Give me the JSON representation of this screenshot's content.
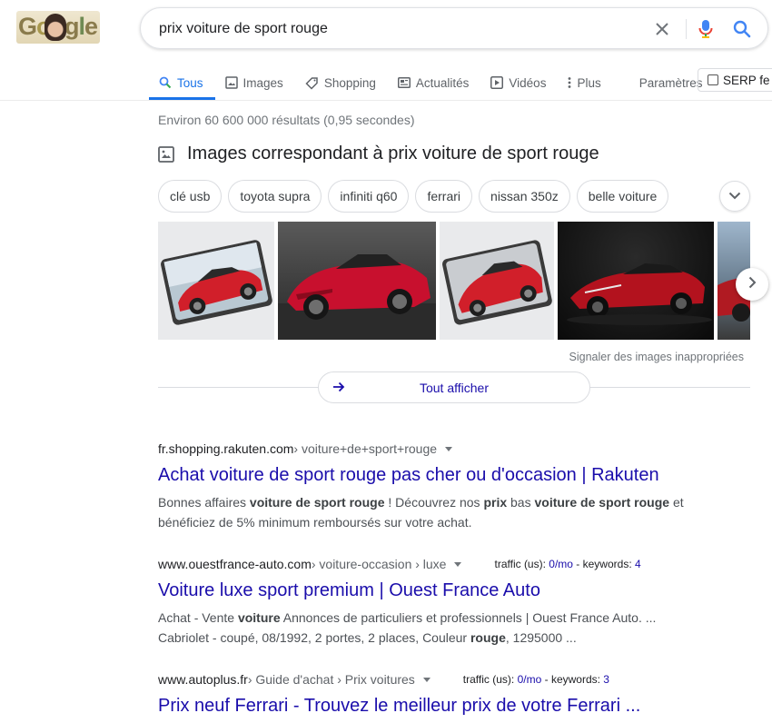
{
  "logo": {
    "text_letters": [
      "G",
      "o",
      "o",
      "g",
      "l",
      "e"
    ]
  },
  "search": {
    "query": "prix voiture de sport rouge"
  },
  "tabs": [
    {
      "label": "Tous",
      "icon": "search-icon",
      "active": true
    },
    {
      "label": "Images",
      "icon": "image-icon"
    },
    {
      "label": "Shopping",
      "icon": "tag-icon"
    },
    {
      "label": "Actualités",
      "icon": "news-icon"
    },
    {
      "label": "Vidéos",
      "icon": "video-icon"
    },
    {
      "label": "Plus",
      "icon": "more-vert-icon"
    }
  ],
  "tools": {
    "params_label": "Paramètres",
    "serp_label": "SERP fe"
  },
  "stats": "Environ 60 600 000 résultats (0,95 secondes)",
  "images_block": {
    "heading": "Images correspondant à prix voiture de sport rouge",
    "chips": [
      "clé usb",
      "toyota supra",
      "infiniti q60",
      "ferrari",
      "nissan 350z",
      "belle voiture"
    ],
    "report": "Signaler des images inappropriées",
    "show_all": "Tout afficher"
  },
  "results": [
    {
      "domain": "fr.shopping.rakuten.com",
      "path": " › voiture+de+sport+rouge",
      "title": "Achat voiture de sport rouge pas cher ou d'occasion | Rakuten",
      "snippet_html": "Bonnes affaires <b>voiture de sport rouge</b> ! Découvrez nos <b>prix</b> bas <b>voiture de sport rouge</b> et bénéficiez de 5% minimum remboursés sur votre achat."
    },
    {
      "domain": "www.ouestfrance-auto.com",
      "path": " › voiture-occasion › luxe",
      "traffic_label": "traffic (us): ",
      "traffic_value": "0/mo",
      "keywords_label": " - keywords: ",
      "keywords_value": "4",
      "title": "Voiture luxe sport premium | Ouest France Auto",
      "snippet_html": "Achat - Vente <b>voiture</b> Annonces de particuliers et professionnels | Ouest France Auto. ... Cabriolet - coupé, 08/1992, 2 portes, 2 places, Couleur <b>rouge</b>, 1295000 ..."
    },
    {
      "domain": "www.autoplus.fr",
      "path": " › Guide d'achat › Prix voitures",
      "traffic_label": "traffic (us): ",
      "traffic_value": "0/mo",
      "keywords_label": " - keywords: ",
      "keywords_value": "3",
      "title": "Prix neuf Ferrari - Trouvez le meilleur prix de votre Ferrari ..."
    }
  ],
  "colors": {
    "link": "#1a0dab",
    "accent": "#1a73e8",
    "mic_red": "#ea4335"
  }
}
